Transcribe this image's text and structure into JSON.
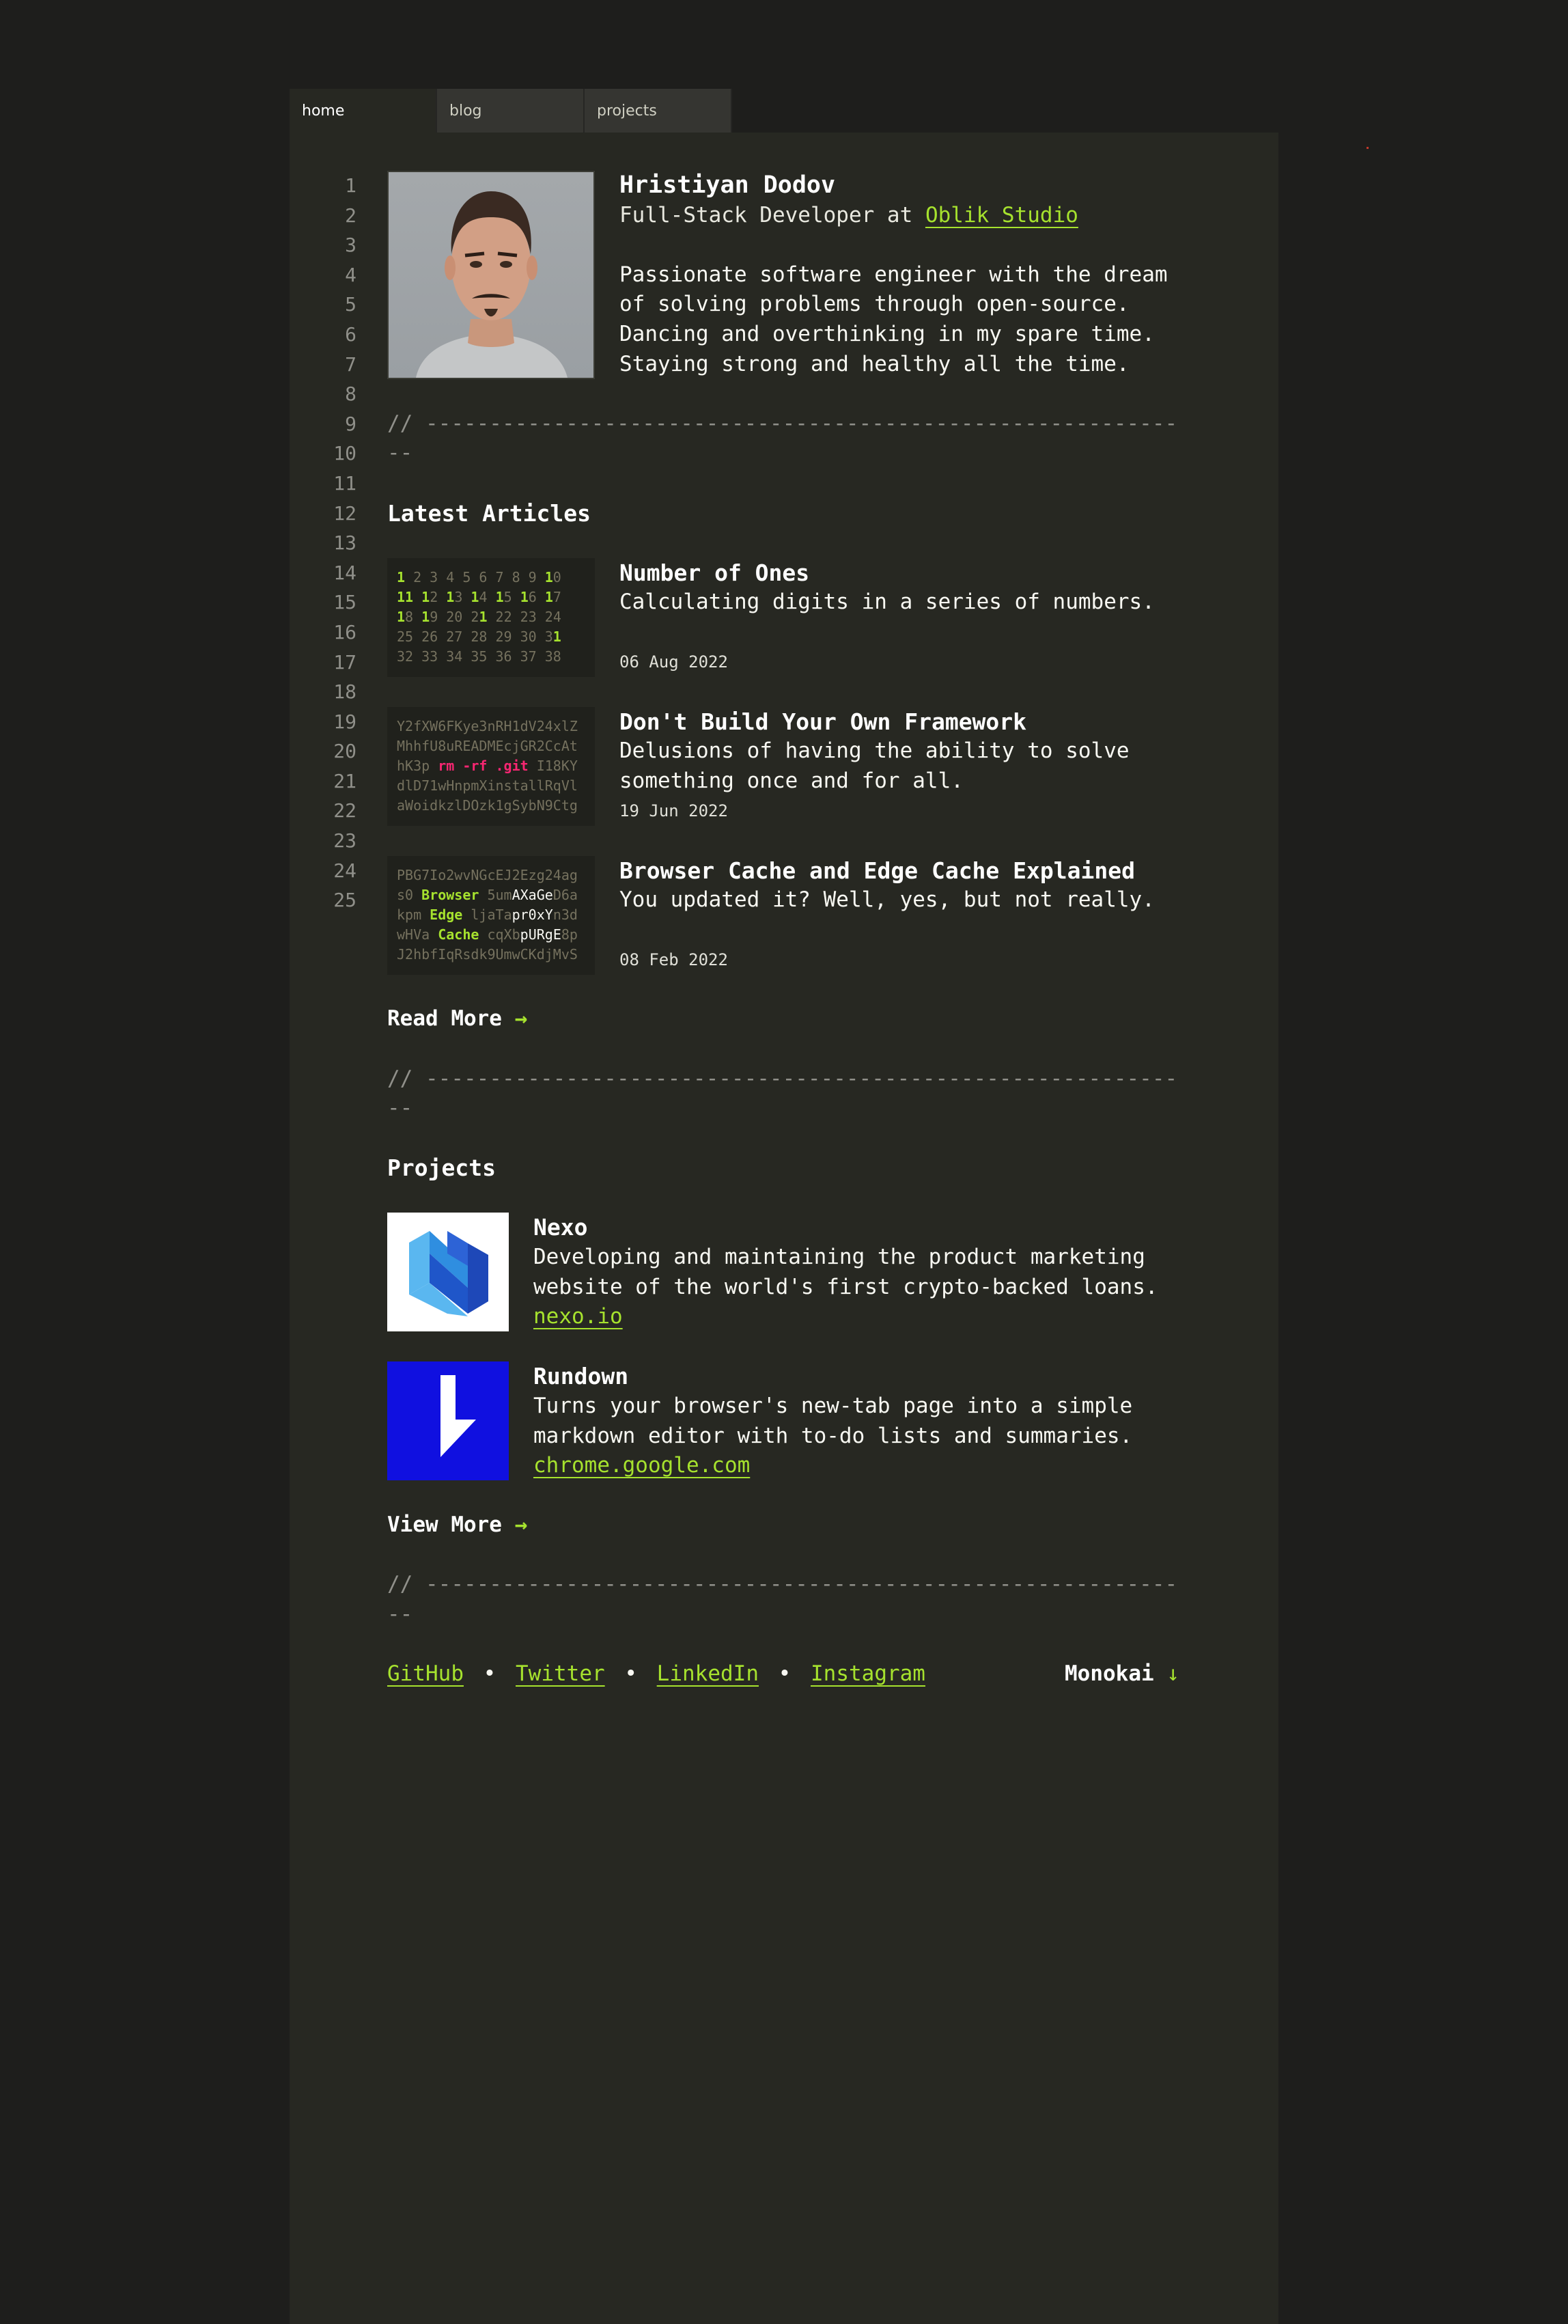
{
  "tabs": [
    {
      "label": "home",
      "active": true
    },
    {
      "label": "blog",
      "active": false
    },
    {
      "label": "projects",
      "active": false
    }
  ],
  "line_numbers": [
    "1",
    "2",
    "3",
    "4",
    "5",
    "6",
    "7",
    "8",
    "9",
    "10",
    "11",
    "12",
    "13",
    "14",
    "15",
    "16",
    "17",
    "18",
    "19",
    "20",
    "21",
    "22",
    "23",
    "24",
    "25"
  ],
  "profile": {
    "name": "Hristiyan Dodov",
    "role_prefix": "Full-Stack Developer at ",
    "company": "Oblik Studio",
    "bio": [
      "Passionate software engineer with the dream",
      "of solving problems through open-source.",
      "Dancing and overthinking in my spare time.",
      "Staying strong and healthy all the time."
    ]
  },
  "divider": "// -------------------------------------------------------------",
  "articles_heading": "Latest Articles",
  "articles": [
    {
      "title": "Number of Ones",
      "description": [
        "Calculating digits in a series of numbers."
      ],
      "date": "06 Aug 2022"
    },
    {
      "title": "Don't Build Your Own Framework",
      "description": [
        "Delusions of having the ability to solve",
        "something once and for all."
      ],
      "date": "19 Jun 2022"
    },
    {
      "title": "Browser Cache and Edge Cache Explained",
      "description": [
        "You updated it? Well, yes, but not really."
      ],
      "date": "08 Feb 2022"
    }
  ],
  "thumbs": {
    "numbers": [
      [
        [
          "1",
          "g"
        ],
        [
          " 2 3 4 5 6 7 8 9 ",
          ""
        ],
        [
          "1",
          "g"
        ],
        [
          "0",
          ""
        ]
      ],
      [
        [
          "11",
          "g"
        ],
        [
          " ",
          ""
        ],
        [
          "1",
          "g"
        ],
        [
          "2 ",
          ""
        ],
        [
          "1",
          "g"
        ],
        [
          "3 ",
          ""
        ],
        [
          "1",
          "g"
        ],
        [
          "4 ",
          ""
        ],
        [
          "1",
          "g"
        ],
        [
          "5 ",
          ""
        ],
        [
          "1",
          "g"
        ],
        [
          "6 ",
          ""
        ],
        [
          "1",
          "g"
        ],
        [
          "7",
          ""
        ]
      ],
      [
        [
          "1",
          "g"
        ],
        [
          "8 ",
          ""
        ],
        [
          "1",
          "g"
        ],
        [
          "9 20 2",
          ""
        ],
        [
          "1",
          "g"
        ],
        [
          " 22 23 24",
          ""
        ]
      ],
      [
        [
          "25 26 27 28 29 30 3",
          ""
        ],
        [
          "1",
          "g"
        ]
      ],
      [
        [
          "32 33 34 35 36 37 38",
          ""
        ]
      ]
    ],
    "framework": [
      [
        [
          "Y2fXW6FKye3nRH1dV24xlZ",
          ""
        ]
      ],
      [
        [
          "MhhfU8uREADMEcjGR2CcAt",
          ""
        ]
      ],
      [
        [
          "hK3p ",
          ""
        ],
        [
          "rm -rf .git",
          "p"
        ],
        [
          " I18KY",
          ""
        ]
      ],
      [
        [
          "dlD71wHnpmXinstallRqVl",
          ""
        ]
      ],
      [
        [
          "aWoidkzlDOzk1gSybN9Ctg",
          ""
        ]
      ]
    ],
    "cache": [
      [
        [
          "PBG7Io2wvNGcEJ2Ezg24ag",
          ""
        ]
      ],
      [
        [
          "s0 ",
          ""
        ],
        [
          "Browser",
          "g"
        ],
        [
          " 5um",
          ""
        ],
        [
          "AXaGe",
          "w"
        ],
        [
          "D6a",
          ""
        ]
      ],
      [
        [
          "kpm ",
          ""
        ],
        [
          "Edge",
          "g"
        ],
        [
          " ljaTa",
          ""
        ],
        [
          "pr0xY",
          "w"
        ],
        [
          "n3d",
          ""
        ]
      ],
      [
        [
          "wHVa ",
          ""
        ],
        [
          "Cache",
          "g"
        ],
        [
          " cqXb",
          ""
        ],
        [
          "pURgE",
          "w"
        ],
        [
          "8p",
          ""
        ]
      ],
      [
        [
          "J2hbfIqRsdk9UmwCKdjMvS",
          ""
        ]
      ]
    ]
  },
  "read_more": "Read More",
  "projects_heading": "Projects",
  "projects": [
    {
      "name": "Nexo",
      "description": [
        "Developing and maintaining the product marketing",
        "website of the world's first crypto-backed loans."
      ],
      "link": "nexo.io",
      "icon": "nexo-logo-icon"
    },
    {
      "name": "Rundown",
      "description": [
        "Turns your browser's new-tab page into a simple",
        "markdown editor with to-do lists and summaries."
      ],
      "link": "chrome.google.com",
      "icon": "rundown-logo-icon"
    }
  ],
  "view_more": "View More",
  "footer": {
    "links": [
      "GitHub",
      "Twitter",
      "LinkedIn",
      "Instagram"
    ],
    "separator": "•",
    "theme": "Monokai"
  },
  "colors": {
    "accent": "#a6e22e",
    "pink": "#f92672",
    "background": "#272822",
    "outer_background": "#1e1e1c"
  }
}
